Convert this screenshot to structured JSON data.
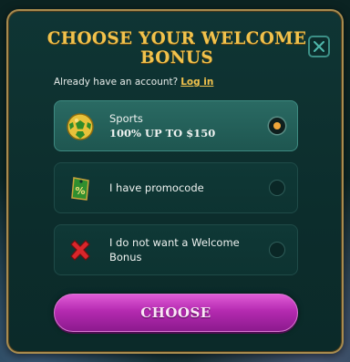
{
  "modal": {
    "title": "CHOOSE YOUR WELCOME BONUS",
    "close_icon": "close-icon",
    "login_prompt": "Already have an account?",
    "login_link": "Log in",
    "options": [
      {
        "icon": "soccer-ball-icon",
        "title": "Sports",
        "subtitle": "100% UP TO $150",
        "selected": true
      },
      {
        "icon": "percent-tag-icon",
        "label": "I have promocode",
        "selected": false
      },
      {
        "icon": "red-x-icon",
        "label_line1": "I do not want a Welcome",
        "label_line2": "Bonus",
        "selected": false
      }
    ],
    "choose_label": "CHOOSE"
  },
  "colors": {
    "accent_gold": "#f1c24c",
    "panel_bg": "#0f3534",
    "selected_bg": "#2a6a63",
    "button_magenta": "#b42ab0",
    "radio_on": "#f0a63a"
  }
}
